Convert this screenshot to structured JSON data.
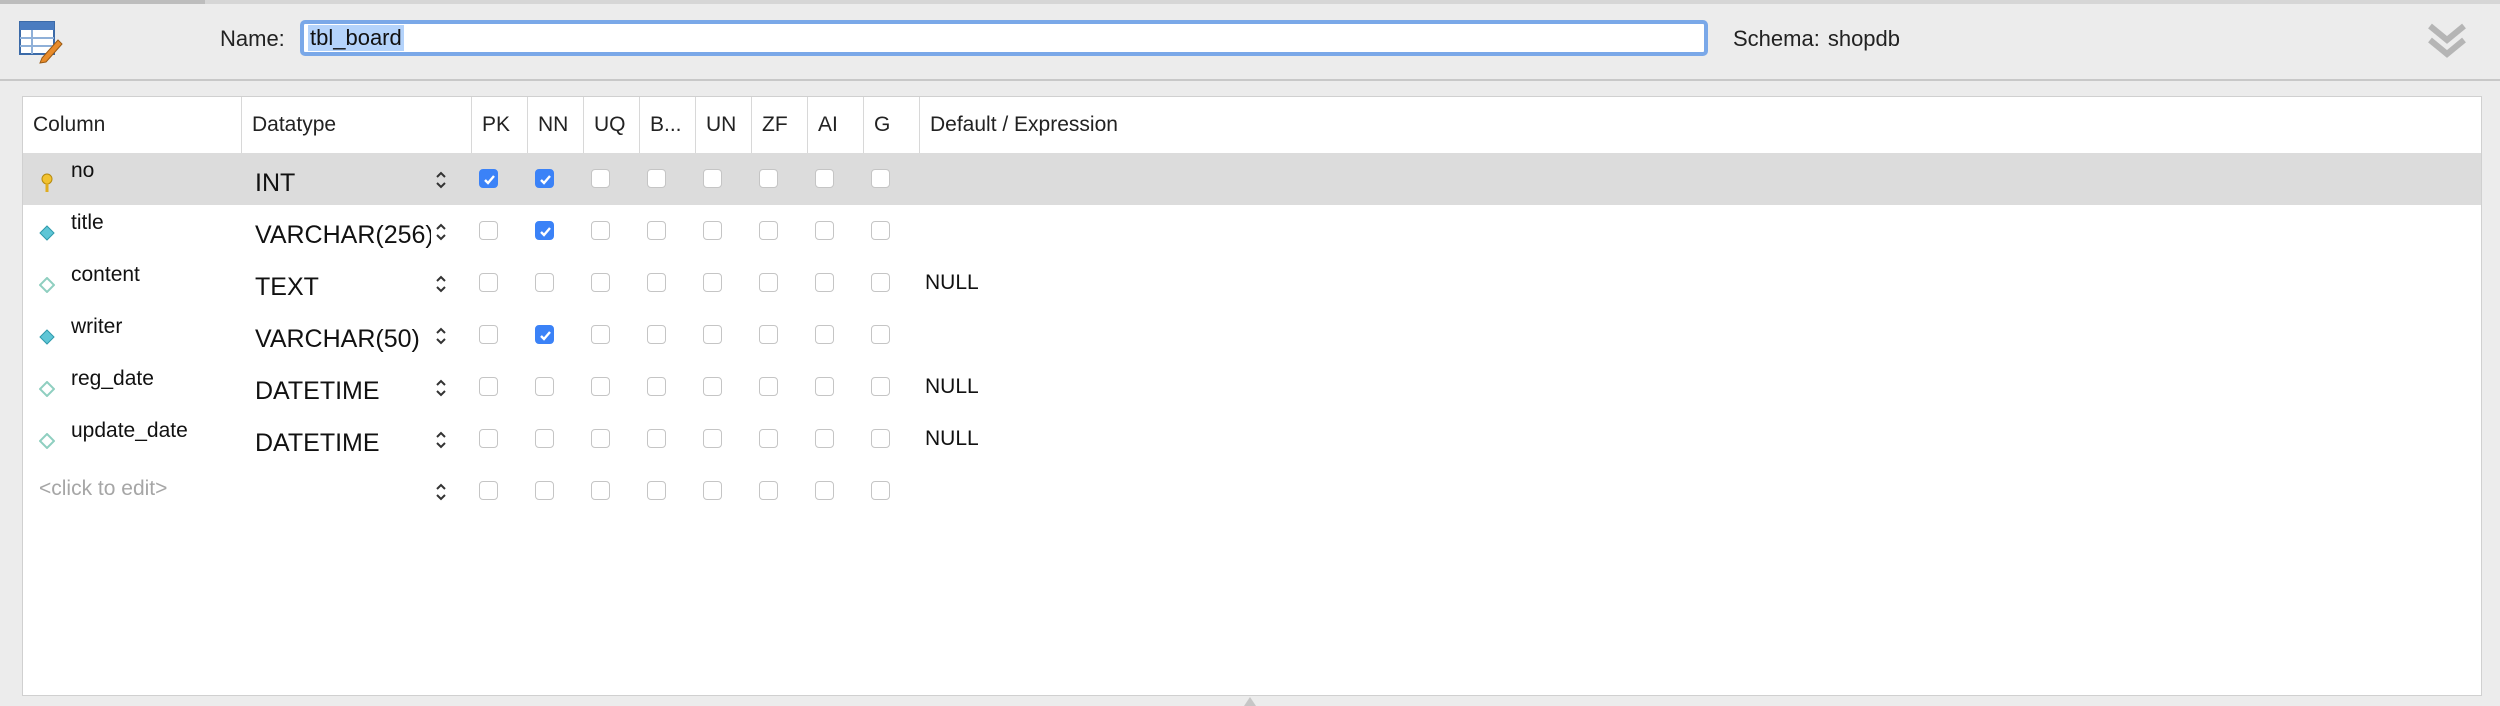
{
  "header": {
    "name_label": "Name:",
    "name_value": "tbl_board",
    "schema_label": "Schema:",
    "schema_value": "shopdb"
  },
  "table": {
    "columns": {
      "column": "Column",
      "datatype": "Datatype",
      "pk": "PK",
      "nn": "NN",
      "uq": "UQ",
      "b": "B...",
      "un": "UN",
      "zf": "ZF",
      "ai": "AI",
      "g": "G",
      "default": "Default / Expression"
    },
    "rows": [
      {
        "name": "no",
        "type": "INT",
        "icon": "primary-key-icon",
        "flags": {
          "pk": true,
          "nn": true,
          "uq": false,
          "b": false,
          "un": false,
          "zf": false,
          "ai": false,
          "g": false
        },
        "default": ""
      },
      {
        "name": "title",
        "type": "VARCHAR(256)",
        "icon": "column-not-null-icon",
        "flags": {
          "pk": false,
          "nn": true,
          "uq": false,
          "b": false,
          "un": false,
          "zf": false,
          "ai": false,
          "g": false
        },
        "default": ""
      },
      {
        "name": "content",
        "type": "TEXT",
        "icon": "column-nullable-icon",
        "flags": {
          "pk": false,
          "nn": false,
          "uq": false,
          "b": false,
          "un": false,
          "zf": false,
          "ai": false,
          "g": false
        },
        "default": "NULL"
      },
      {
        "name": "writer",
        "type": "VARCHAR(50)",
        "icon": "column-not-null-icon",
        "flags": {
          "pk": false,
          "nn": true,
          "uq": false,
          "b": false,
          "un": false,
          "zf": false,
          "ai": false,
          "g": false
        },
        "default": ""
      },
      {
        "name": "reg_date",
        "type": "DATETIME",
        "icon": "column-nullable-icon",
        "flags": {
          "pk": false,
          "nn": false,
          "uq": false,
          "b": false,
          "un": false,
          "zf": false,
          "ai": false,
          "g": false
        },
        "default": "NULL"
      },
      {
        "name": "update_date",
        "type": "DATETIME",
        "icon": "column-nullable-icon",
        "flags": {
          "pk": false,
          "nn": false,
          "uq": false,
          "b": false,
          "un": false,
          "zf": false,
          "ai": false,
          "g": false
        },
        "default": "NULL"
      }
    ],
    "placeholder_row": {
      "name": "<click to edit>"
    }
  },
  "colors": {
    "checkbox_checked": "#3b82f7",
    "selected_row": "#dcdcdc",
    "focus_ring": "#7aa8e8",
    "text_selection": "#b4d3fb"
  }
}
